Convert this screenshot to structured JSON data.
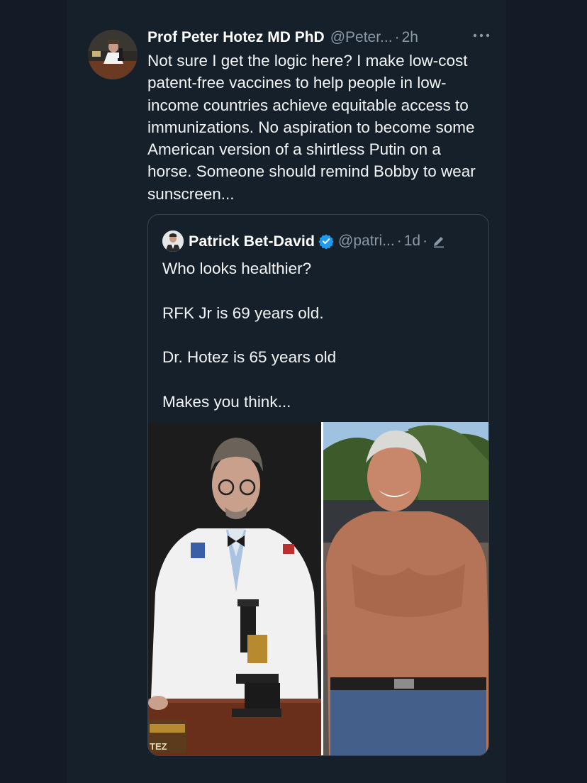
{
  "tweet": {
    "display_name": "Prof Peter Hotez MD PhD",
    "handle": "@Peter...",
    "separator": "·",
    "time": "2h",
    "more_icon": "more-horizontal-icon",
    "text": "Not sure I get the logic here? I make low-cost patent-free vaccines to help people in low-income countries achieve equitable access to immunizations. No aspiration to become some American version of a shirtless Putin on a horse. Someone should remind Bobby to wear sunscreen..."
  },
  "quote": {
    "display_name": "Patrick Bet-David",
    "verified_icon": "verified-badge-icon",
    "handle": "@patri...",
    "separator": "·",
    "time": "1d",
    "edit_icon": "edited-pencil-icon",
    "lines": [
      "Who looks healthier?",
      "RFK Jr is 69 years old.",
      "Dr. Hotez is 65 years old",
      "Makes you think..."
    ]
  },
  "colors": {
    "background": "#15202b",
    "text": "#e7e9ea",
    "secondary_text": "#8b98a5",
    "verified_blue": "#1d9bf0",
    "border": "#38444d"
  },
  "media": {
    "left_caption": "TEZ"
  }
}
